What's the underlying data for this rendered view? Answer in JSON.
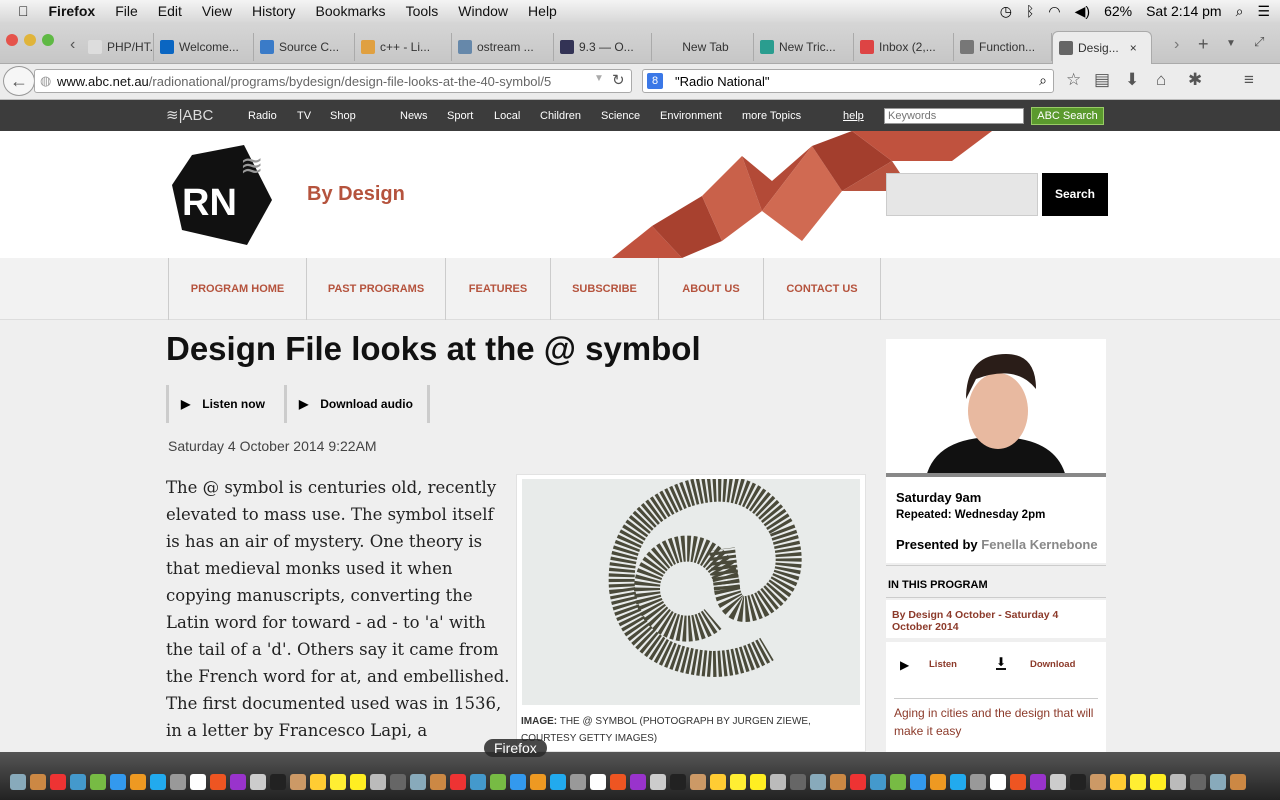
{
  "menubar": {
    "app": "Firefox",
    "items": [
      "File",
      "Edit",
      "View",
      "History",
      "Bookmarks",
      "Tools",
      "Window",
      "Help"
    ],
    "battery": "62%",
    "clock": "Sat 2:14 pm"
  },
  "tabs": [
    {
      "label": "PHP/HT...",
      "color": "#ddd"
    },
    {
      "label": "Welcome...",
      "color": "#0a66c2"
    },
    {
      "label": "Source C...",
      "color": "#3a7bc8"
    },
    {
      "label": "c++ - Li...",
      "color": "#e0a040"
    },
    {
      "label": "ostream ...",
      "color": "#6688aa"
    },
    {
      "label": "9.3 — O...",
      "color": "#335"
    },
    {
      "label": "New Tab",
      "color": ""
    },
    {
      "label": "New Tric...",
      "color": "#2a9d8f"
    },
    {
      "label": "Inbox (2,...",
      "color": "#d44"
    },
    {
      "label": "Function...",
      "color": "#777"
    },
    {
      "label": "Desig...",
      "color": "#666",
      "active": true
    }
  ],
  "navbar": {
    "url_domain": "www.abc.net.au",
    "url_path": "/radionational/programs/bydesign/design-file-looks-at-the-40-symbol/5",
    "search_value": "\"Radio National\""
  },
  "abcbar": {
    "logo": "ABC",
    "links": [
      "Radio",
      "TV",
      "Shop",
      "News",
      "Sport",
      "Local",
      "Children",
      "Science",
      "Environment",
      "more Topics"
    ],
    "help": "help",
    "keywords_placeholder": "Keywords",
    "search_button": "ABC Search"
  },
  "header": {
    "logo": "RN",
    "program": "By Design",
    "search_button": "Search"
  },
  "progmenu": [
    "PROGRAM HOME",
    "PAST PROGRAMS",
    "FEATURES",
    "SUBSCRIBE",
    "ABOUT US",
    "CONTACT US"
  ],
  "article": {
    "title": "Design File looks at the @ symbol",
    "listen": "Listen now",
    "download": "Download audio",
    "date": "Saturday 4 October 2014 9:22AM",
    "body": "The @ symbol is centuries old, recently elevated to mass use. The symbol itself is has an air of mystery. One theory is that medieval monks used it when copying manuscripts, converting the Latin word for toward - ad - to 'a' with the tail of a 'd'. Others say it came from the French word for at, and embellished. The first documented used was in 1536, in a letter by Francesco Lapi, a Florentine merchant, who used @ to denote units of wine called amphorae.",
    "image_label": "IMAGE:",
    "image_caption": "THE @ SYMBOL (PHOTOGRAPH BY JURGEN ZIEWE, COURTESY GETTY IMAGES)"
  },
  "sidebar": {
    "time": "Saturday 9am",
    "repeat": "Repeated: Wednesday 2pm",
    "presented_by": "Presented by",
    "presenter": "Fenella Kernebone",
    "in_this_program": "IN THIS PROGRAM",
    "episode": "By Design 4 October - Saturday 4 October 2014",
    "listen": "Listen",
    "download": "Download",
    "story": "Aging in cities and the design that will make it easy"
  },
  "dock": {
    "tooltip": "Firefox"
  },
  "colors": {
    "accent": "#b5533d",
    "dark_bar": "#3c3c3c",
    "abc_search": "#5b9a2e"
  }
}
